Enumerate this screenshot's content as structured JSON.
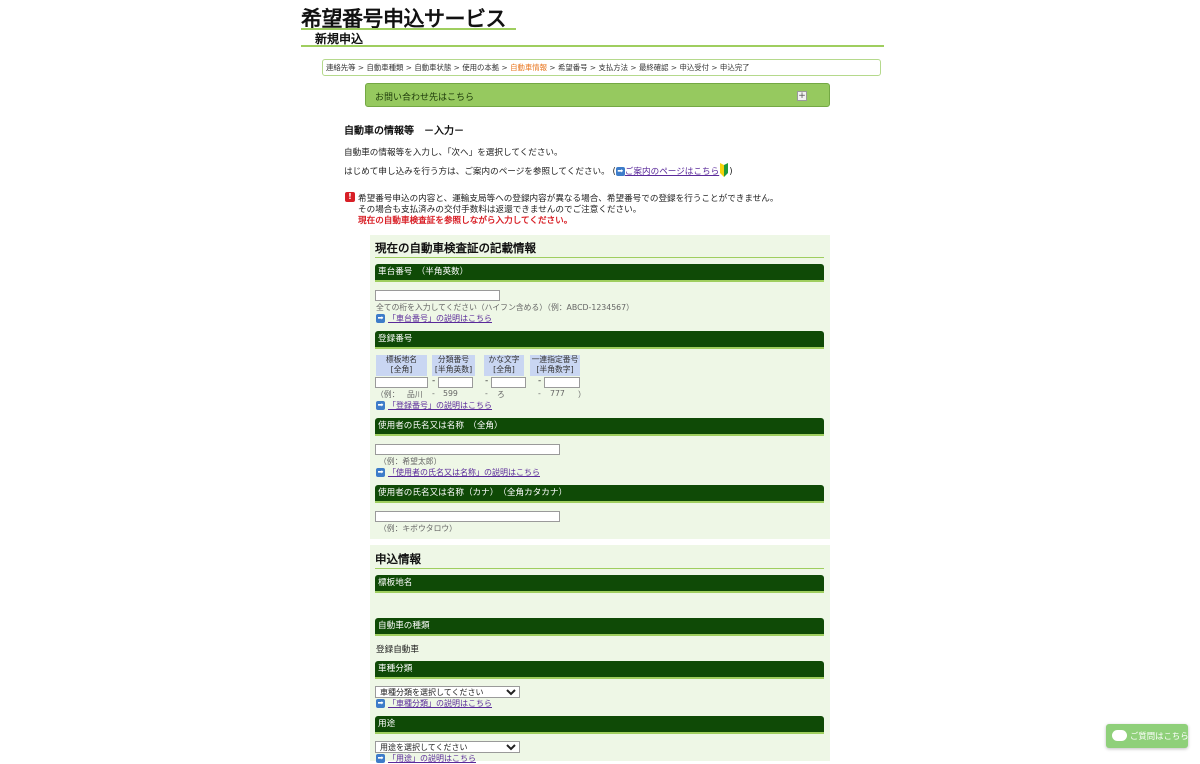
{
  "header": {
    "service_title": "希望番号申込サービス",
    "subtitle": "新規申込"
  },
  "breadcrumb": {
    "steps": [
      "連絡先等",
      "自動車種類",
      "自動車状態",
      "使用の本拠",
      "自動車情報",
      "希望番号",
      "支払方法",
      "最終確認",
      "申込受付",
      "申込完了"
    ],
    "separator": " > ",
    "current_index": 4
  },
  "inquiry": {
    "label": "お問い合わせ先はこちら",
    "toggle_symbol": "+"
  },
  "page": {
    "section_title": "自動車の情報等　－入力－",
    "intro_line1": "自動車の情報等を入力し、「次へ」を選択してください。",
    "intro_line2_prefix": "はじめて申し込みを行う方は、ご案内のページを参照してください。 (",
    "intro_link": "ご案内のページはこちら",
    "intro_suffix": ")",
    "warning_line1": "希望番号申込の内容と、運輸支局等への登録内容が異なる場合、希望番号での登録を行うことができません。",
    "warning_line2": "その場合も支払済みの交付手数料は返還できませんのでご注意ください。",
    "warning_line3": "現在の自動車検査証を参照しながら入力してください。"
  },
  "cert_panel": {
    "title": "現在の自動車検査証の記載情報",
    "chassis": {
      "label": "車台番号　（半角英数）",
      "value": "",
      "hint": "全ての桁を入力してください（ハイフン含める）（例：ABCD-1234567）",
      "help": "「車台番号」の説明はこちら"
    },
    "registration": {
      "label": "登録番号",
      "columns": [
        {
          "name": "標板地名",
          "type": "[全角]",
          "example": "品川"
        },
        {
          "name": "分類番号",
          "type": "[半角英数]",
          "example": "599"
        },
        {
          "name": "かな文字",
          "type": "[全角]",
          "example": "ろ"
        },
        {
          "name": "一連指定番号",
          "type": "[半角数字]",
          "example": "777"
        }
      ],
      "example_prefix": "（例：",
      "example_suffix": "）",
      "dash": "-",
      "values": [
        "",
        "",
        "",
        ""
      ],
      "help": "「登録番号」の説明はこちら"
    },
    "user_name": {
      "label": "使用者の氏名又は名称　（全角）",
      "value": "",
      "hint": "（例：希望太郎）",
      "help": "「使用者の氏名又は名称」の説明はこちら"
    },
    "user_name_kana": {
      "label": "使用者の氏名又は名称（カナ）　（全角カタカナ）",
      "value": "",
      "hint": "（例：キボウタロウ）"
    }
  },
  "apply_panel": {
    "title": "申込情報",
    "plate_area": {
      "label": "標板地名",
      "value": ""
    },
    "vehicle_kind": {
      "label": "自動車の種類",
      "value": "登録自動車"
    },
    "car_class": {
      "label": "車種分類",
      "selected": "車種分類を選択してください",
      "help": "「車種分類」の説明はこちら"
    },
    "usage": {
      "label": "用途",
      "selected": "用途を選択してください",
      "help": "「用途」の説明はこちら"
    }
  },
  "chat": {
    "label": "ご質問はこちら"
  },
  "colors": {
    "accent_green": "#9fce5f",
    "bar_dark_green": "#0f4a06",
    "inquiry_green": "#96c95f",
    "warning_red": "#d81f26",
    "current_step_orange": "#e8741c",
    "link_purple": "#5a2a9a"
  },
  "icons": {
    "help_arrow": "arrow-right-icon",
    "warning": "exclamation-icon",
    "beginner": "beginner-mark-icon",
    "chat": "chat-bubble-icon"
  }
}
